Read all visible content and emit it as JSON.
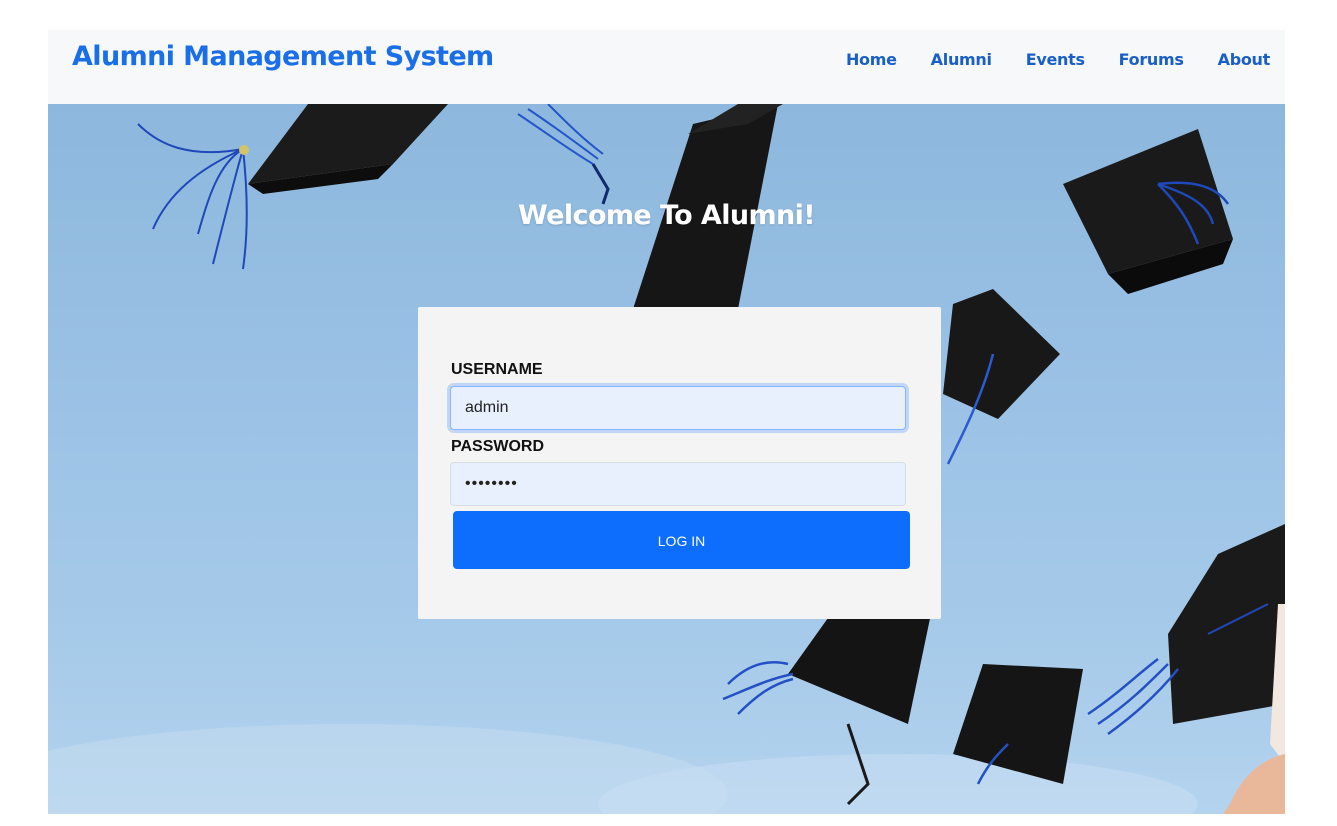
{
  "navbar": {
    "brand": "Alumni Management System",
    "links": [
      "Home",
      "Alumni",
      "Events",
      "Forums",
      "About"
    ]
  },
  "hero": {
    "title": "Welcome To Alumni!"
  },
  "login": {
    "username_label": "USERNAME",
    "username_value": "admin",
    "password_label": "PASSWORD",
    "password_value": "••••••••",
    "submit_label": "LOG IN"
  },
  "colors": {
    "brand": "#1a6fe8",
    "nav_link": "#1a5fc8",
    "primary_button": "#0d6efd",
    "sky": "#9cc3e6",
    "card": "#f4f4f5"
  }
}
